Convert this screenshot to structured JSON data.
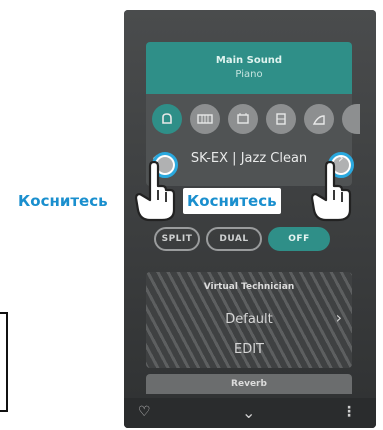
{
  "main_sound": {
    "title": "Main Sound",
    "subtitle": "Piano",
    "icons": [
      "piano-icon",
      "keyboard-icon",
      "organ-icon",
      "harpsichord-icon",
      "strings-icon"
    ],
    "selected_sound": "SK-EX | Jazz Clean"
  },
  "modes": [
    "SPLIT",
    "DUAL",
    "OFF"
  ],
  "virtual_technician": {
    "title": "Virtual Technician",
    "value": "Default",
    "edit_label": "EDIT"
  },
  "reverb": {
    "title": "Reverb"
  },
  "callouts": {
    "left": "Коснитесь",
    "right": "Коснитесь"
  },
  "colors": {
    "accent": "#2f8f88",
    "callout": "#1a8fce",
    "ring": "#2aa9df"
  }
}
